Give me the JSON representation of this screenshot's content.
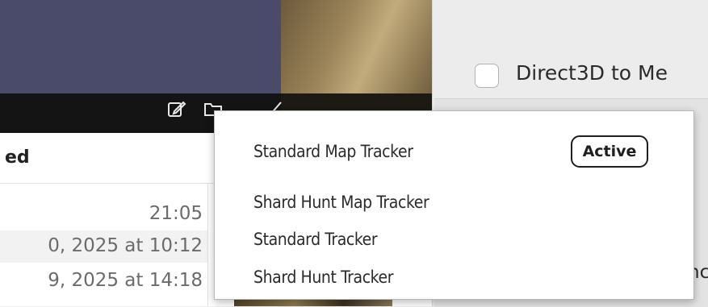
{
  "left_panel": {
    "header_partial": "ed",
    "rows": [
      {
        "text": "21:05"
      },
      {
        "text": "0, 2025 at 10:12"
      },
      {
        "text": "9, 2025 at 14:18"
      }
    ],
    "icons": [
      "edit-icon",
      "folder-icon",
      "pencil-icon"
    ]
  },
  "right_panel": {
    "checkbox_label": "Direct3D to Me",
    "checkbox_checked": false,
    "partial_text": "nc"
  },
  "tracker_menu": {
    "items": [
      {
        "label": "Standard Map Tracker",
        "badge": "Active"
      },
      {
        "label": "Shard Hunt Map Tracker"
      },
      {
        "label": "Standard Tracker"
      },
      {
        "label": "Shard Hunt Tracker"
      }
    ]
  },
  "colors": {
    "banner": "#4a4b6a",
    "menu_background": "#ffffff",
    "window_background": "#ececec"
  }
}
